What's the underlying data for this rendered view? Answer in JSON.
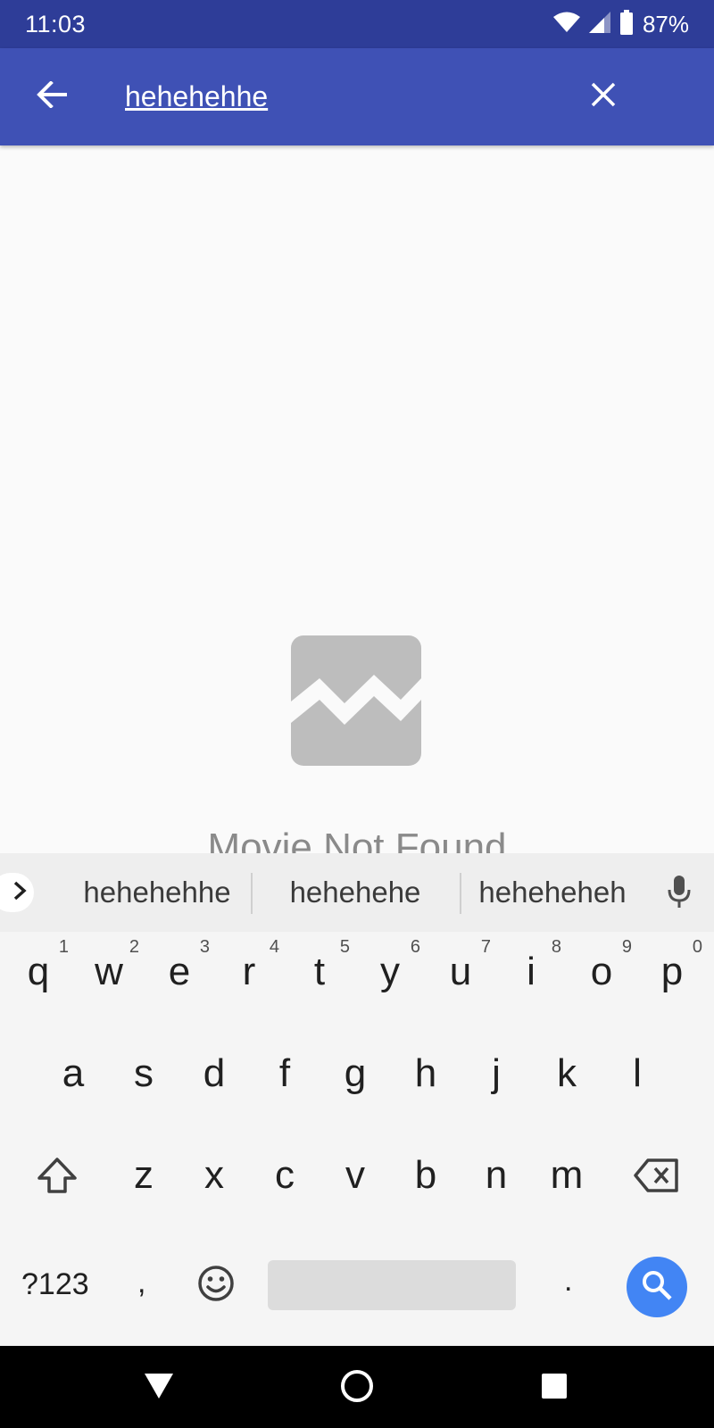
{
  "status_bar": {
    "time": "11:03",
    "battery": "87%"
  },
  "app_bar": {
    "search_value": "hehehehhe",
    "color": "#3f51b5"
  },
  "empty_state": {
    "icon": "broken-image-icon",
    "message": "Movie Not Found"
  },
  "keyboard": {
    "suggestions": [
      "hehehehhe",
      "hehehehe",
      "heheheheh"
    ],
    "row1": [
      {
        "key": "q",
        "hint": "1"
      },
      {
        "key": "w",
        "hint": "2"
      },
      {
        "key": "e",
        "hint": "3"
      },
      {
        "key": "r",
        "hint": "4"
      },
      {
        "key": "t",
        "hint": "5"
      },
      {
        "key": "y",
        "hint": "6"
      },
      {
        "key": "u",
        "hint": "7"
      },
      {
        "key": "i",
        "hint": "8"
      },
      {
        "key": "o",
        "hint": "9"
      },
      {
        "key": "p",
        "hint": "0"
      }
    ],
    "row2": [
      "a",
      "s",
      "d",
      "f",
      "g",
      "h",
      "j",
      "k",
      "l"
    ],
    "row3": [
      "z",
      "x",
      "c",
      "v",
      "b",
      "n",
      "m"
    ],
    "symbols_label": "?123",
    "comma": ",",
    "period": ".",
    "action_color": "#4285f4"
  }
}
